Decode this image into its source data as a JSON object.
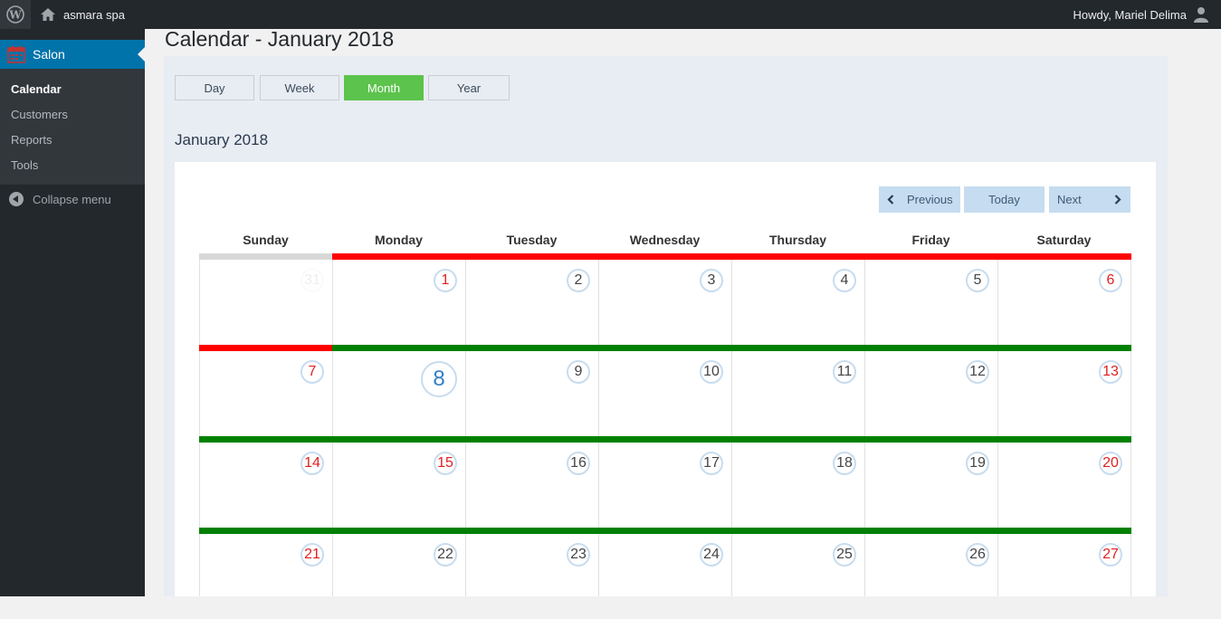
{
  "adminbar": {
    "site_name": "asmara spa",
    "howdy": "Howdy, Mariel Delima"
  },
  "sidebar": {
    "menu_title": "Salon",
    "items": [
      {
        "label": "Calendar",
        "current": true
      },
      {
        "label": "Customers",
        "current": false
      },
      {
        "label": "Reports",
        "current": false
      },
      {
        "label": "Tools",
        "current": false
      }
    ],
    "collapse_label": "Collapse menu"
  },
  "page": {
    "title": "Calendar - January 2018",
    "month_heading": "January 2018"
  },
  "views": [
    {
      "label": "Day",
      "active": false
    },
    {
      "label": "Week",
      "active": false
    },
    {
      "label": "Month",
      "active": true
    },
    {
      "label": "Year",
      "active": false
    }
  ],
  "nav": {
    "previous": "Previous",
    "today": "Today",
    "next": "Next"
  },
  "calendar": {
    "weekdays": [
      "Sunday",
      "Monday",
      "Tuesday",
      "Wednesday",
      "Thursday",
      "Friday",
      "Saturday"
    ],
    "weeks": [
      [
        {
          "day": "31",
          "style": "faded",
          "bar": "gray"
        },
        {
          "day": "1",
          "style": "red",
          "bar": "red"
        },
        {
          "day": "2",
          "style": "normal",
          "bar": "red"
        },
        {
          "day": "3",
          "style": "normal",
          "bar": "red"
        },
        {
          "day": "4",
          "style": "normal",
          "bar": "red"
        },
        {
          "day": "5",
          "style": "normal",
          "bar": "red"
        },
        {
          "day": "6",
          "style": "red",
          "bar": "red"
        }
      ],
      [
        {
          "day": "7",
          "style": "red",
          "bar": "red"
        },
        {
          "day": "8",
          "style": "today",
          "bar": "green"
        },
        {
          "day": "9",
          "style": "normal",
          "bar": "green"
        },
        {
          "day": "10",
          "style": "normal",
          "bar": "green"
        },
        {
          "day": "11",
          "style": "normal",
          "bar": "green"
        },
        {
          "day": "12",
          "style": "normal",
          "bar": "green"
        },
        {
          "day": "13",
          "style": "red",
          "bar": "green"
        }
      ],
      [
        {
          "day": "14",
          "style": "red",
          "bar": "green"
        },
        {
          "day": "15",
          "style": "red",
          "bar": "green"
        },
        {
          "day": "16",
          "style": "normal",
          "bar": "green"
        },
        {
          "day": "17",
          "style": "normal",
          "bar": "green"
        },
        {
          "day": "18",
          "style": "normal",
          "bar": "green"
        },
        {
          "day": "19",
          "style": "normal",
          "bar": "green"
        },
        {
          "day": "20",
          "style": "red",
          "bar": "green"
        }
      ],
      [
        {
          "day": "21",
          "style": "red",
          "bar": "green"
        },
        {
          "day": "22",
          "style": "normal",
          "bar": "green"
        },
        {
          "day": "23",
          "style": "normal",
          "bar": "green"
        },
        {
          "day": "24",
          "style": "normal",
          "bar": "green"
        },
        {
          "day": "25",
          "style": "normal",
          "bar": "green"
        },
        {
          "day": "26",
          "style": "normal",
          "bar": "green"
        },
        {
          "day": "27",
          "style": "red",
          "bar": "green"
        }
      ]
    ],
    "bar_colors": {
      "red": "#ff0000",
      "green": "#008000",
      "gray": "#d8d8d8"
    }
  },
  "icons": {
    "wp_logo": "wordpress-logo-icon",
    "home": "home-icon",
    "user": "user-avatar-icon",
    "calendar": "calendar-icon",
    "collapse": "collapse-arrow-icon",
    "prev": "chevron-left-icon",
    "next": "chevron-right-icon"
  }
}
